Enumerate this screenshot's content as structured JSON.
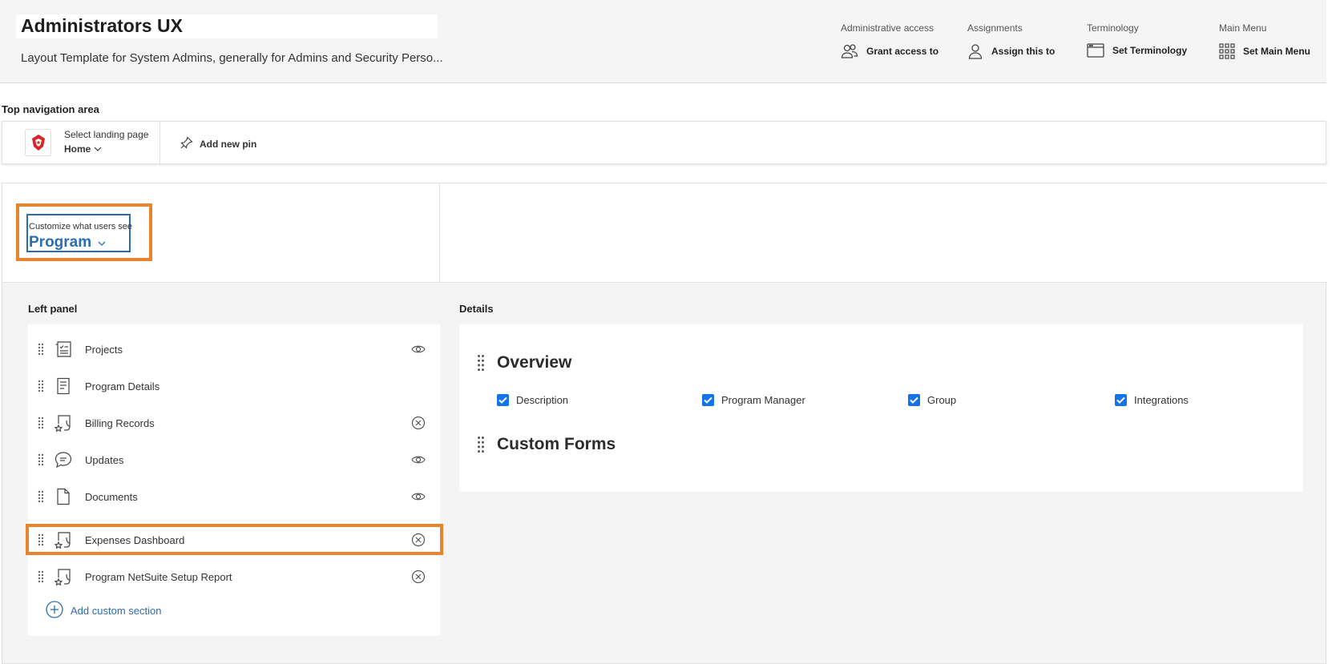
{
  "header": {
    "title": "Administrators UX",
    "subtitle": "Layout Template for System Admins, generally for Admins and Security Perso...",
    "actions": [
      {
        "caption": "Administrative access",
        "label": "Grant access to",
        "icon": "users-icon"
      },
      {
        "caption": "Assignments",
        "label": "Assign this to",
        "icon": "user-icon"
      },
      {
        "caption": "Terminology",
        "label": "Set Terminology",
        "icon": "browser-window-icon"
      },
      {
        "caption": "Main Menu",
        "label": "Set Main Menu",
        "icon": "grid-icon"
      }
    ]
  },
  "top_nav": {
    "section_label": "Top navigation area",
    "landing_caption": "Select landing page",
    "landing_value": "Home",
    "add_pin_label": "Add new pin"
  },
  "customize": {
    "caption": "Customize what users see",
    "value": "Program"
  },
  "left_panel": {
    "label": "Left panel",
    "items": [
      {
        "label": "Projects",
        "icon": "checklist-icon",
        "action": "eye-icon"
      },
      {
        "label": "Program Details",
        "icon": "document-lines-icon",
        "action": ""
      },
      {
        "label": "Billing Records",
        "icon": "report-star-icon",
        "action": "remove-icon"
      },
      {
        "label": "Updates",
        "icon": "chat-bubble-icon",
        "action": "eye-icon"
      },
      {
        "label": "Documents",
        "icon": "document-icon",
        "action": "eye-icon"
      },
      {
        "label": "Expenses Dashboard",
        "icon": "report-star-icon",
        "action": "remove-icon"
      },
      {
        "label": "Program NetSuite Setup Report",
        "icon": "report-star-icon",
        "action": "remove-icon"
      }
    ],
    "add_custom_label": "Add custom section"
  },
  "details": {
    "label": "Details",
    "sections": [
      {
        "title": "Overview",
        "fields": [
          {
            "label": "Description",
            "checked": true
          },
          {
            "label": "Program Manager",
            "checked": true
          },
          {
            "label": "Group",
            "checked": true
          },
          {
            "label": "Integrations",
            "checked": true
          }
        ]
      },
      {
        "title": "Custom Forms",
        "fields": []
      }
    ]
  },
  "colors": {
    "accent_blue": "#2b6db5",
    "checkbox_blue": "#1473e6",
    "highlight_orange": "#e8832e",
    "logo_red": "#e01f26"
  }
}
